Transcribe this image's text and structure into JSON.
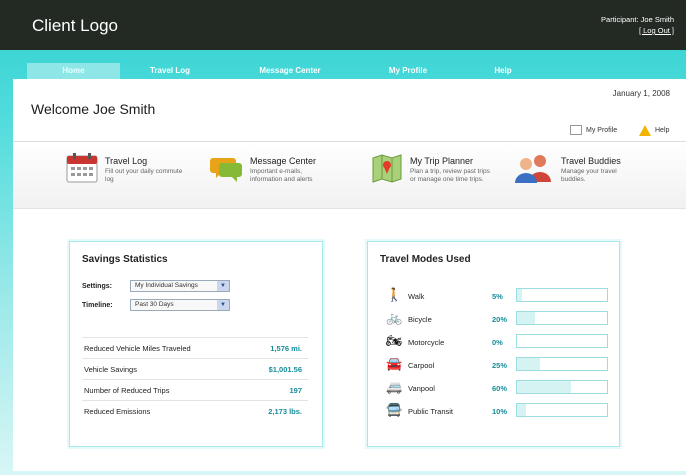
{
  "header": {
    "logo": "Client Logo",
    "participant": "Participant: Joe Smith",
    "logout": "[ Log Out ]"
  },
  "nav": {
    "items": [
      {
        "label": "Home",
        "active": true
      },
      {
        "label": "Travel Log"
      },
      {
        "label": "Message Center"
      },
      {
        "label": "My Profile"
      },
      {
        "label": "Help"
      }
    ]
  },
  "main": {
    "welcome": "Welcome Joe Smith",
    "date": "January 1, 2008",
    "my_profile_link": "My Profile",
    "help_link": "Help"
  },
  "quick_links": [
    {
      "title": "Travel Log",
      "desc": "Fill out your daily commute log",
      "icon": "calendar-icon"
    },
    {
      "title": "Message Center",
      "desc": "Important e-mails, information and alerts",
      "icon": "speech-bubbles-icon"
    },
    {
      "title": "My Trip Planner",
      "desc": "Plan a trip, review past trips or manage one time trips.",
      "icon": "map-icon"
    },
    {
      "title": "Travel Buddies",
      "desc": "Manage your travel buddies.",
      "icon": "people-icon"
    }
  ],
  "savings": {
    "title": "Savings Statistics",
    "settings_label": "Settings:",
    "settings_value": "My Individual Savings",
    "timeline_label": "Timeline:",
    "timeline_value": "Past 30 Days",
    "stats": [
      {
        "label": "Reduced Vehicle Miles Traveled",
        "value": "1,576 mi."
      },
      {
        "label": "Vehicle Savings",
        "value": "$1,001.56"
      },
      {
        "label": "Number of Reduced Trips",
        "value": "197"
      },
      {
        "label": "Reduced Emissions",
        "value": "2,173 lbs."
      }
    ]
  },
  "modes": {
    "title": "Travel Modes Used",
    "items": [
      {
        "label": "Walk",
        "pct": "5%",
        "fraction": 0.05,
        "icon": "walk-icon"
      },
      {
        "label": "Bicycle",
        "pct": "20%",
        "fraction": 0.2,
        "icon": "bicycle-icon"
      },
      {
        "label": "Motorcycle",
        "pct": "0%",
        "fraction": 0.0,
        "icon": "motorcycle-icon"
      },
      {
        "label": "Carpool",
        "pct": "25%",
        "fraction": 0.25,
        "icon": "car-icon"
      },
      {
        "label": "Vanpool",
        "pct": "60%",
        "fraction": 0.6,
        "icon": "van-icon"
      },
      {
        "label": "Public Transit",
        "pct": "10%",
        "fraction": 0.1,
        "icon": "bus-icon"
      }
    ]
  }
}
